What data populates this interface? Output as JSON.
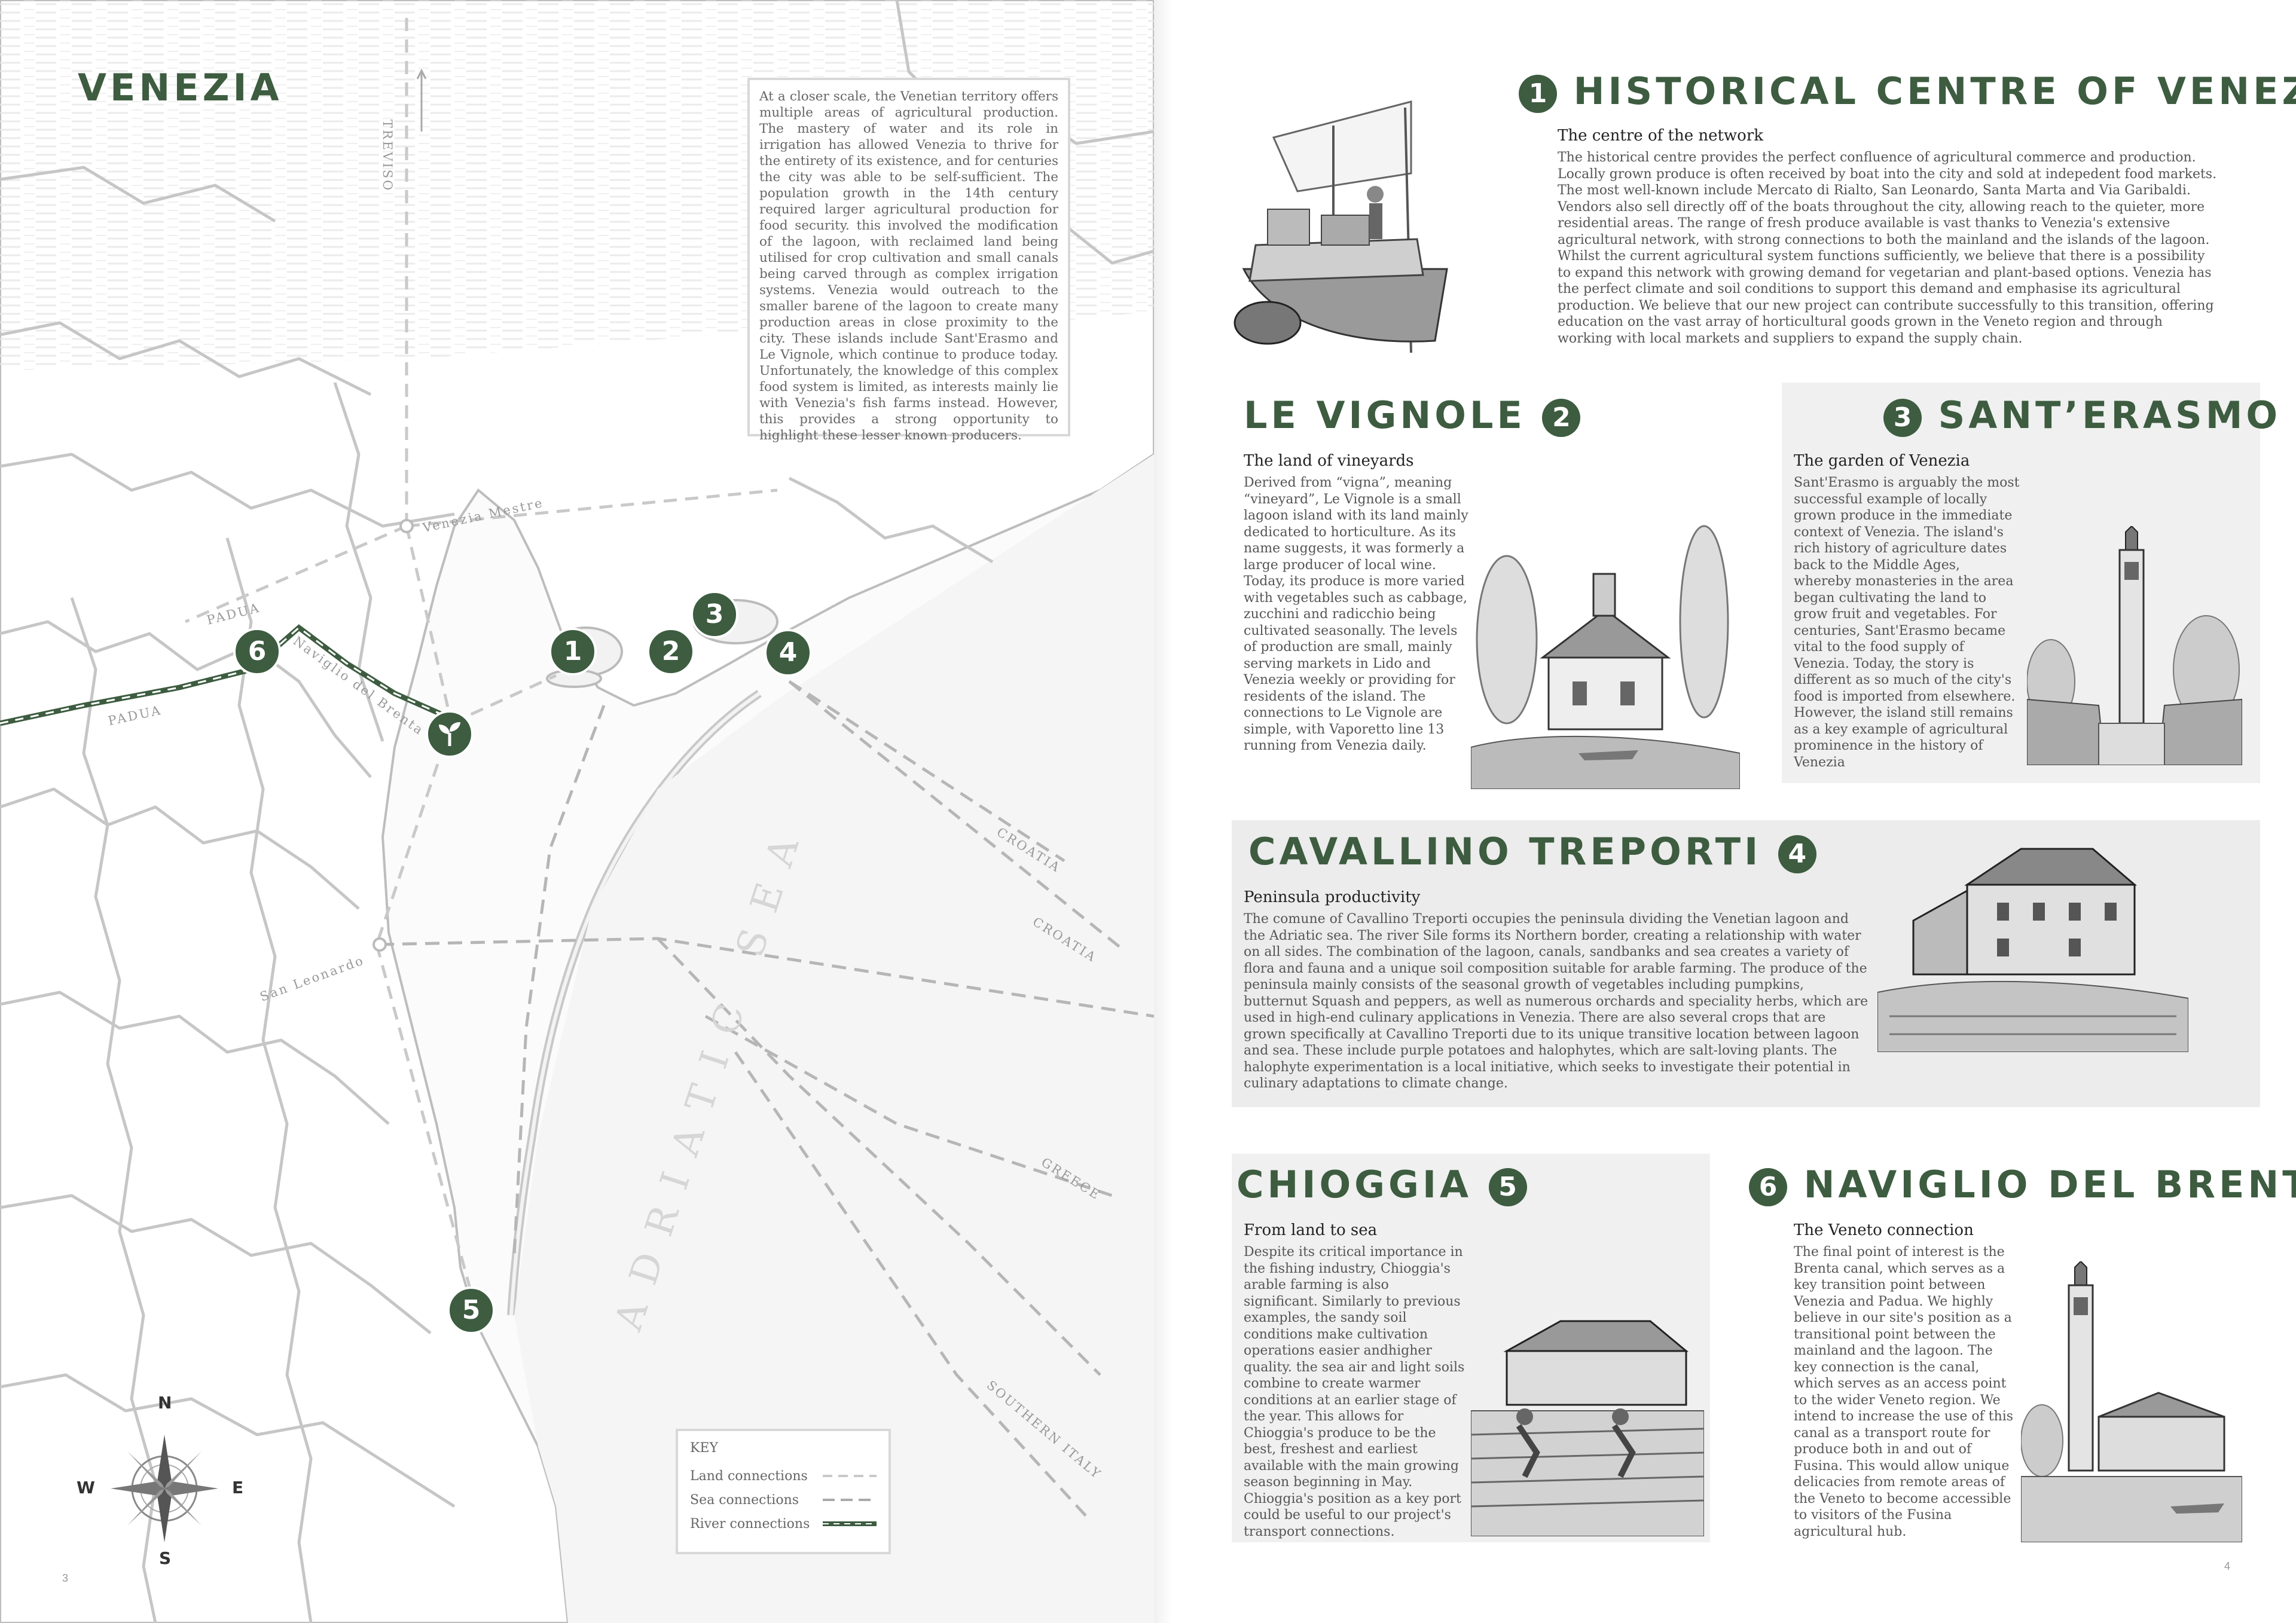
{
  "left_page": {
    "title": "VENEZIA",
    "intro_text": "At a closer scale, the Venetian territory offers multiple areas of agricultural production. The mastery of water and its role in irrigation has allowed Venezia to thrive for the entirety of its existence, and for centuries the city was able to be self-sufficient. The population growth in the 14th century required larger agricultural production for food security. this involved the modification of the lagoon, with reclaimed land being utilised for crop cultivation and small canals being carved through as complex irrigation systems. Venezia would outreach to the smaller barene of the lagoon to create many production areas in close proximity to the city. These islands include Sant'Erasmo and Le Vignole, which continue to produce today. Unfortunately, the knowledge of this complex food system is limited, as interests mainly lie with Venezia's fish farms instead. However, this provides a strong opportunity to highlight these lesser known producers.",
    "map_labels": {
      "treviso": "TREVISO",
      "venezia_mestre": "Venezia Mestre",
      "padua_top": "PADUA",
      "padua_bottom": "PADUA",
      "naviglio": "Naviglio del Brenta",
      "san_leonardo": "San Leonardo",
      "adriatic": "ADRIATIC SEA",
      "croatia_1": "CROATIA",
      "croatia_2": "CROATIA",
      "greece": "GREECE",
      "southern_italy": "SOUTHERN ITALY"
    },
    "markers": [
      "1",
      "2",
      "3",
      "4",
      "5",
      "6"
    ],
    "key": {
      "title": "KEY",
      "land": "Land connections",
      "sea": "Sea connections",
      "river": "River connections"
    },
    "compass": {
      "n": "N",
      "s": "S",
      "e": "E",
      "w": "W"
    },
    "page_number": "3",
    "colors": {
      "accent": "#3d5c40",
      "land": "#ffffff",
      "sea": "#f0f1f0",
      "boundary": "#c6c6c6"
    }
  },
  "right_page": {
    "page_number": "4",
    "sections": [
      {
        "number": "1",
        "title": "HISTORICAL CENTRE OF VENEZIA",
        "subtitle": "The centre of the network",
        "text": "The historical centre provides the perfect confluence of agricultural commerce and production. Locally grown produce is often received by boat into the city and sold at indepedent food markets. The most well-known include Mercato di Rialto, San Leonardo, Santa Marta and Via Garibaldi. Vendors also sell directly off of the boats throughout the city, allowing reach to the quieter, more residential areas. The range of fresh produce available is vast thanks to Venezia's extensive agricultural network, with strong connections to both the mainland and the islands of the lagoon. Whilst the current agricultural system functions sufficiently, we believe that there is a possibility to expand this network with growing demand for vegetarian and plant-based options. Venezia has the perfect climate and soil conditions to support this demand and emphasise its agricultural production. We believe that our new project can contribute successfully to this transition, offering education on the vast array of horticultural goods grown in the Veneto region and through working with local markets and suppliers to expand the supply chain.",
        "illustration": "market-boat-illustration"
      },
      {
        "number": "2",
        "title": "LE VIGNOLE",
        "subtitle": "The land of vineyards",
        "text": "Derived from “vigna”, meaning “vineyard”, Le Vignole is a small lagoon island with its land mainly dedicated to horticulture. As its name suggests, it was formerly a large producer of local wine. Today, its produce is more varied with vegetables such as cabbage, zucchini and radicchio being cultivated seasonally. The levels of production are small, mainly serving markets in Lido and Venezia weekly or providing for residents of the island. The connections to Le Vignole are simple, with Vaporetto line 13 running from Venezia daily.",
        "illustration": "chapel-illustration"
      },
      {
        "number": "3",
        "title": "SANT’ERASMO",
        "subtitle": "The garden of Venezia",
        "text": "Sant'Erasmo is arguably the most successful example of locally grown produce in the immediate context of Venezia. The island's rich history of agriculture dates back to the Middle Ages, whereby monasteries in the area began cultivating the land to grow fruit and vegetables. For centuries, Sant'Erasmo became vital to the food supply of Venezia. Today, the story is different as so much of the city's food is imported from elsewhere. However, the island still remains as a key example of agricultural prominence in the history of Venezia",
        "illustration": "bell-tower-illustration"
      },
      {
        "number": "4",
        "title": "CAVALLINO TREPORTI",
        "subtitle": "Peninsula productivity",
        "text": "The comune of Cavallino Treporti occupies the peninsula dividing the Venetian lagoon and the Adriatic sea. The river Sile forms its Northern border, creating a relationship with water on all sides. The combination of the lagoon, canals, sandbanks and sea creates a variety of flora and fauna and a unique soil composition suitable for arable farming. The produce of the peninsula mainly consists of the seasonal growth of vegetables including pumpkins, butternut Squash and peppers, as well as numerous orchards and speciality herbs, which are used in high-end culinary applications in Venezia. There are also several crops that are grown specifically at Cavallino Treporti due to its unique transitive location between lagoon and sea. These include purple potatoes and halophytes, which are salt-loving plants. The halophyte experimentation is a local initiative, which seeks to investigate their potential in culinary adaptations to climate change.",
        "illustration": "farmhouse-illustration"
      },
      {
        "number": "5",
        "title": "CHIOGGIA",
        "subtitle": "From land to sea",
        "text": "Despite its critical importance in the fishing industry, Chioggia's arable farming is also significant. Similarly to previous examples, the sandy soil conditions make cultivation operations easier andhigher quality. the sea air and light soils combine to create warmer conditions at an earlier stage of the year. This allows for Chioggia's produce to be the best, freshest and earliest available with the main growing season beginning in May. Chioggia's position as a key port could be useful to our project's transport connections.",
        "illustration": "farmers-field-illustration"
      },
      {
        "number": "6",
        "title": "NAVIGLIO DEL BRENTA",
        "subtitle": "The Veneto connection",
        "text": "The final point of interest is the Brenta canal, which serves as a key transition point between Venezia and Padua. We highly believe in our site's position as a transitional point between the mainland and the lagoon. The key connection is the canal, which serves as an access point to the wider Veneto region. We intend to increase the use of this canal as a transport route for produce both in and out of Fusina. This would allow unique delicacies from remote areas of the Veneto to become accessible to visitors of the Fusina agricultural hub.",
        "illustration": "canal-tower-illustration"
      }
    ]
  }
}
